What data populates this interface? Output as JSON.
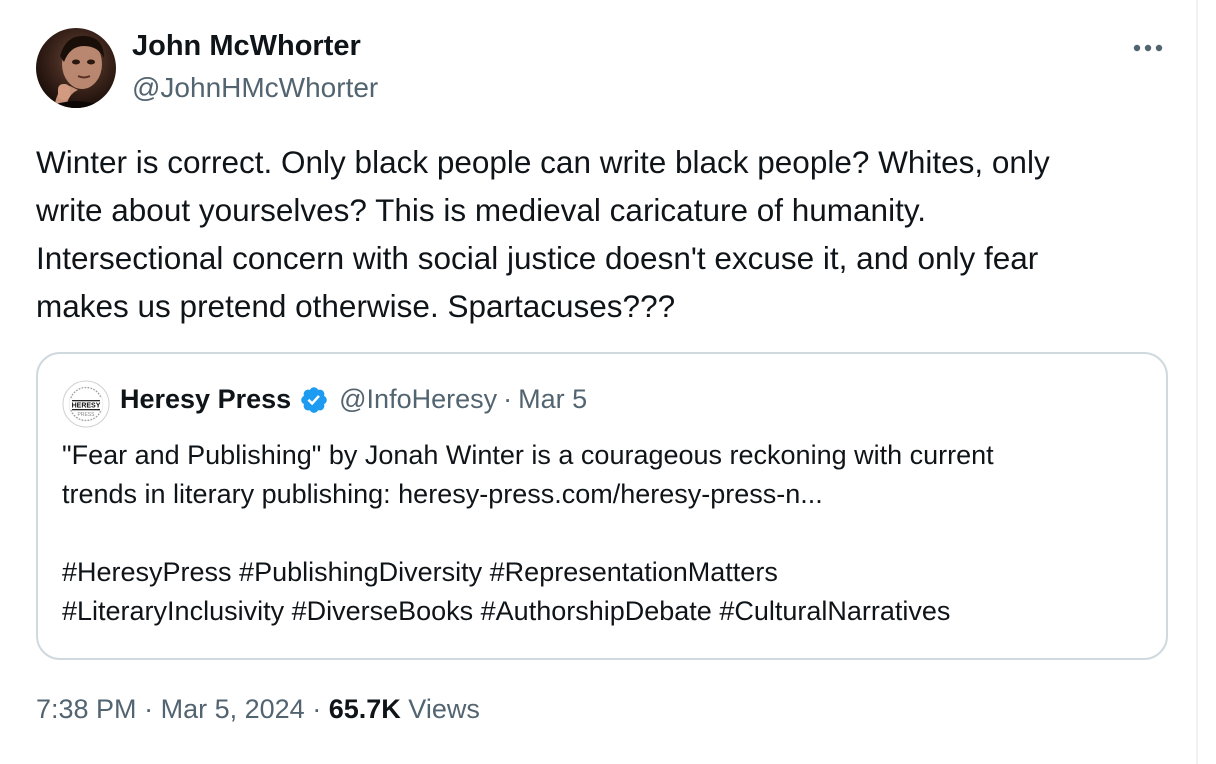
{
  "author": {
    "name": "John McWhorter",
    "handle": "@JohnHMcWhorter"
  },
  "icons": {
    "more": "more-horizontal-icon",
    "verified": "verified-badge-icon"
  },
  "tweet": {
    "lines": [
      "Winter is correct. Only black people can write black people? Whites, only",
      "write about yourselves? This is medieval caricature of humanity.",
      "Intersectional concern with social justice doesn't excuse it, and only fear",
      "makes us pretend otherwise. Spartacuses???"
    ]
  },
  "quote": {
    "name": "Heresy Press",
    "handle": "@InfoHeresy",
    "separator": "·",
    "date": "Mar 5",
    "lines": [
      "\"Fear and Publishing\" by Jonah Winter is a courageous reckoning with current",
      "trends in literary publishing: heresy-press.com/heresy-press-n...",
      "#HeresyPress #PublishingDiversity #RepresentationMatters",
      "#LiteraryInclusivity #DiverseBooks #AuthorshipDebate #CulturalNarratives"
    ],
    "logo": {
      "top_text": "UNBOUNDED CREATIVITY",
      "bottom_text": "FEARLESS EXPRESSION",
      "title": "HERESY",
      "subtitle": "PRESS"
    }
  },
  "meta": {
    "time": "7:38 PM",
    "date": "Mar 5, 2024",
    "separator": "·",
    "views_count": "65.7K",
    "views_label": "Views"
  },
  "colors": {
    "text": "#0f1419",
    "secondary": "#536471",
    "border": "#cfd9de",
    "verified": "#1d9bf0"
  }
}
